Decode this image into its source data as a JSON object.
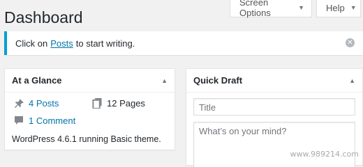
{
  "header": {
    "title": "Dashboard",
    "screen_options_label": "Screen Options",
    "help_label": "Help"
  },
  "notice": {
    "text_before": "Click on",
    "link_text": "Posts",
    "text_after": "to start writing."
  },
  "at_a_glance": {
    "title": "At a Glance",
    "posts": "4 Posts",
    "pages": "12 Pages",
    "comments": "1 Comment",
    "footer": "WordPress 4.6.1 running Basic theme."
  },
  "quick_draft": {
    "title": "Quick Draft",
    "title_placeholder": "Title",
    "content_placeholder": "What’s on your mind?"
  },
  "watermark": "www.989214.com",
  "colors": {
    "link": "#0073aa",
    "notice_border": "#00a0d2",
    "background": "#f1f1f1"
  }
}
